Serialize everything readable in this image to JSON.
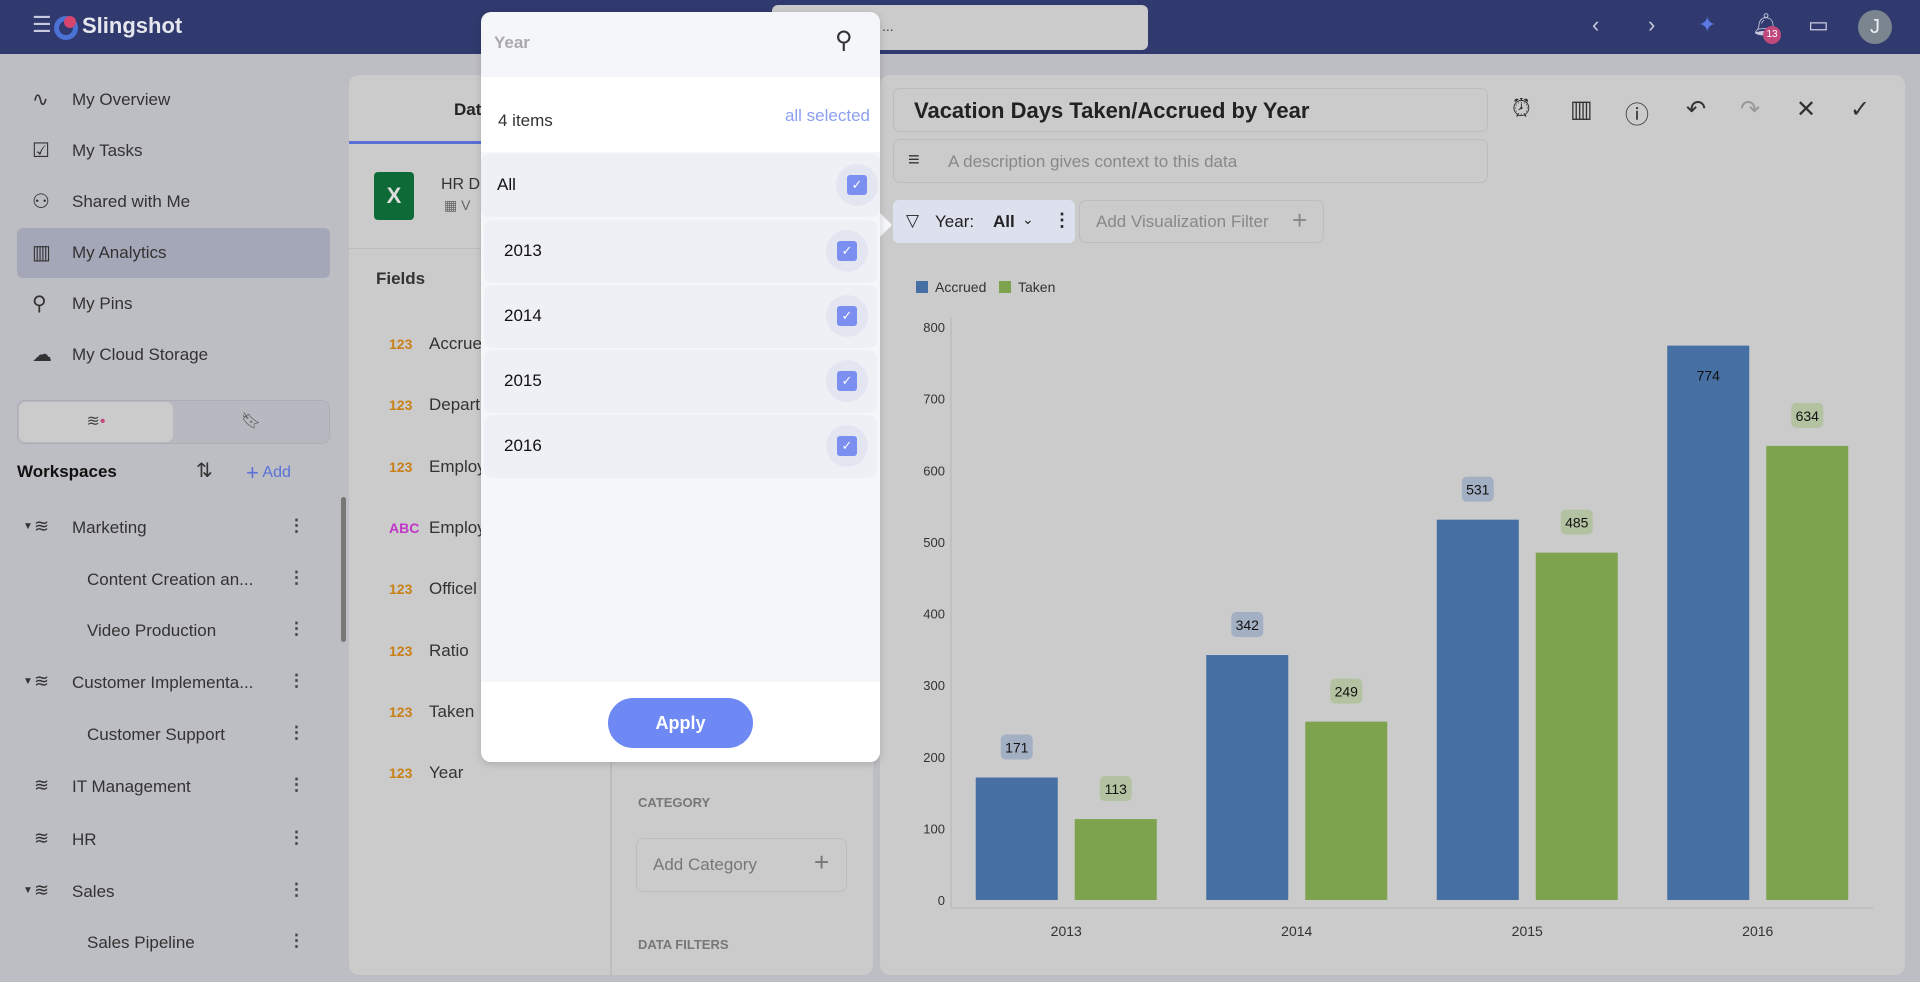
{
  "header": {
    "app_name": "Slingshot",
    "search_text": "...",
    "notification_count": "13",
    "avatar_initial": "J"
  },
  "sidebar": {
    "nav": [
      {
        "label": "My Overview",
        "icon": "pulse-icon"
      },
      {
        "label": "My Tasks",
        "icon": "clipboard-icon"
      },
      {
        "label": "Shared with Me",
        "icon": "user-check-icon"
      },
      {
        "label": "My Analytics",
        "icon": "bar-chart-icon",
        "active": true
      },
      {
        "label": "My Pins",
        "icon": "pin-icon"
      },
      {
        "label": "My Cloud Storage",
        "icon": "cloud-icon"
      }
    ],
    "workspaces_title": "Workspaces",
    "add_label": "Add",
    "tree": [
      {
        "label": "Marketing",
        "level": 0,
        "expanded": true
      },
      {
        "label": "Content Creation an...",
        "level": 1
      },
      {
        "label": "Video Production",
        "level": 1
      },
      {
        "label": "Customer Implementa...",
        "level": 0,
        "expanded": true
      },
      {
        "label": "Customer Support",
        "level": 1
      },
      {
        "label": "IT Management",
        "level": 0
      },
      {
        "label": "HR",
        "level": 0
      },
      {
        "label": "Sales",
        "level": 0,
        "expanded": true
      },
      {
        "label": "Sales Pipeline",
        "level": 1
      }
    ]
  },
  "data_panel": {
    "tab_label": "Dat",
    "source_name": "HR D",
    "source_sub": "V",
    "fields_title": "Fields",
    "fields": [
      {
        "type": "123",
        "name": "Accrue"
      },
      {
        "type": "123",
        "name": "Depart"
      },
      {
        "type": "123",
        "name": "Employ"
      },
      {
        "type": "ABC",
        "name": "Employ"
      },
      {
        "type": "123",
        "name": "Officel"
      },
      {
        "type": "123",
        "name": "Ratio"
      },
      {
        "type": "123",
        "name": "Taken"
      },
      {
        "type": "123",
        "name": "Year"
      }
    ],
    "category_title": "CATEGORY",
    "add_category": "Add Category",
    "data_filters_title": "DATA FILTERS"
  },
  "popup": {
    "search_placeholder": "Year",
    "count": "4 items",
    "all_selected": "all selected",
    "all_label": "All",
    "items": [
      {
        "label": "2013",
        "checked": true
      },
      {
        "label": "2014",
        "checked": true
      },
      {
        "label": "2015",
        "checked": true
      },
      {
        "label": "2016",
        "checked": true
      }
    ],
    "apply": "Apply"
  },
  "viz": {
    "title": "Vacation Days Taken/Accrued by Year",
    "description_placeholder": "A description gives context to this data",
    "filter_name": "Year:",
    "filter_value": "All",
    "add_filter": "Add Visualization Filter"
  },
  "chart_data": {
    "type": "bar",
    "categories": [
      "2013",
      "2014",
      "2015",
      "2016"
    ],
    "series": [
      {
        "name": "Accrued",
        "color": "#4670a3",
        "values": [
          171,
          342,
          531,
          774
        ]
      },
      {
        "name": "Taken",
        "color": "#7ea34f",
        "values": [
          113,
          249,
          485,
          634
        ]
      }
    ],
    "ylim": [
      0,
      800
    ],
    "yticks": [
      0,
      100,
      200,
      300,
      400,
      500,
      600,
      700,
      800
    ],
    "legend": "top-left",
    "grid": false
  }
}
